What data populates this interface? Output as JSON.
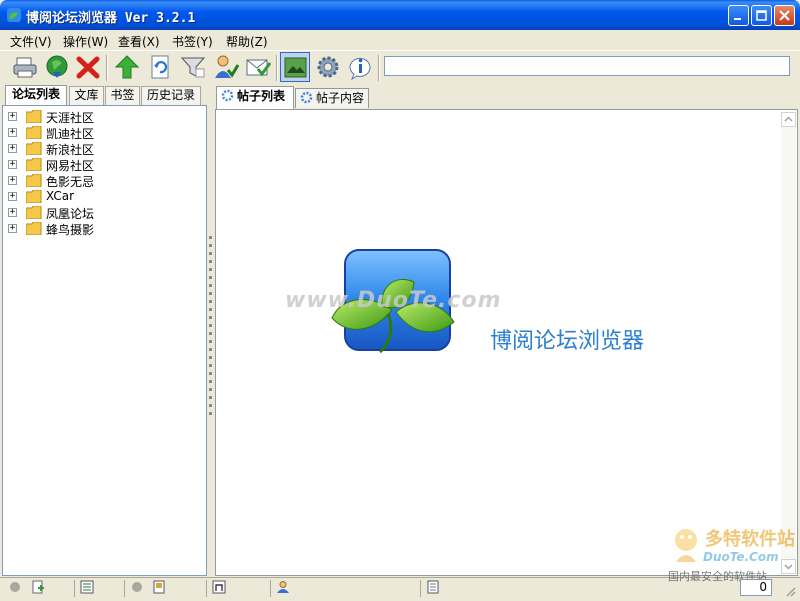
{
  "window": {
    "title": "博阅论坛浏览器 Ver 3.2.1"
  },
  "menu": [
    {
      "label": "文件(V)"
    },
    {
      "label": "操作(W)"
    },
    {
      "label": "查看(X)"
    },
    {
      "label": "书签(Y)"
    },
    {
      "label": "帮助(Z)"
    }
  ],
  "toolbar": {
    "buttons": [
      "printer-icon",
      "download-globe-icon",
      "delete-x-icon",
      "up-arrow-icon",
      "refresh-doc-icon",
      "filter-funnel-icon",
      "user-check-icon",
      "mail-check-icon",
      "image-view-icon",
      "gear-icon",
      "info-icon"
    ],
    "address_value": ""
  },
  "left_tabs": [
    {
      "label": "论坛列表",
      "selected": true
    },
    {
      "label": "文库"
    },
    {
      "label": "书签"
    },
    {
      "label": "历史记录"
    }
  ],
  "forum_tree": [
    {
      "label": "天涯社区"
    },
    {
      "label": "凯迪社区"
    },
    {
      "label": "新浪社区"
    },
    {
      "label": "网易社区"
    },
    {
      "label": "色影无忌"
    },
    {
      "label": "XCar"
    },
    {
      "label": "凤凰论坛"
    },
    {
      "label": "蜂鸟摄影"
    }
  ],
  "right_tabs": [
    {
      "label": "帖子列表",
      "selected": true
    },
    {
      "label": "帖子内容"
    }
  ],
  "splash": {
    "watermark": "www.DuoTe.com",
    "app_name": "博阅论坛浏览器"
  },
  "status": {
    "count": "0"
  },
  "corner_watermark": {
    "brand": "多特软件站",
    "site": "DuoTe.Com",
    "slogan": "国内最安全的软件站"
  },
  "colors": {
    "title_bar": "#0058ee",
    "accent_text": "#2c7fd1",
    "folder": "#f5c84a"
  }
}
